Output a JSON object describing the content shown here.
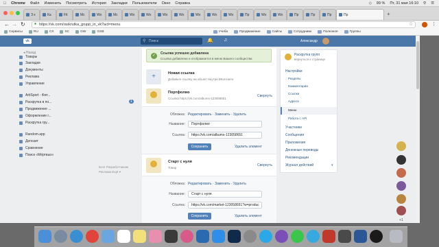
{
  "menubar": {
    "app": "Chrome",
    "items": [
      "Файл",
      "Изменить",
      "Посмотреть",
      "История",
      "Закладки",
      "Пользователи",
      "Окно",
      "Справка"
    ],
    "battery": "99 %",
    "clock": "Пт, 31 мая 16:10"
  },
  "tabs": [
    "З к",
    "Ка",
    "Fit",
    "Mc",
    "Wo",
    "Mc",
    "Wo",
    "Wo",
    "Wo",
    "Wo",
    "Wo",
    "Wo",
    "Wo",
    "Пр",
    "Wo",
    "Wo",
    "Пр",
    "Пр",
    "Пр",
    "Пр"
  ],
  "addressbar": {
    "url": "https://vk.com/raskrutka_grupp_in_vk?act=menu"
  },
  "bookmarks": {
    "items": [
      "Сервисы",
      "RU",
      "CX",
      "SC",
      "GW",
      "GSB"
    ],
    "folders": [
      "Учеба",
      "Продвижение",
      "Сайты",
      "Сотрудники",
      "Полезное",
      "Группы"
    ]
  },
  "vk": {
    "search_placeholder": "Поиск",
    "user_name": "Александр"
  },
  "left_nav": {
    "back": "Назад",
    "items": [
      "Товары",
      "Закладки",
      "Документы",
      "Реклама",
      "Управление",
      "ArtiSport - Фит...",
      "Раскрутка в по...",
      "Продвижение ...",
      "Оформление г...",
      "Раскрутка гру..."
    ],
    "counts": [
      "",
      "",
      "",
      "",
      "",
      "",
      "1",
      "",
      "",
      ""
    ],
    "apps": [
      "Random.app",
      "Депозит",
      "Сравнение",
      "Поиск «Мёртвых»"
    ],
    "footer": "Блог  Разработчикам  Реклама  Ещё ▾"
  },
  "toast": {
    "title": "Ссылка успешно добавлена",
    "text": "Ссылка добавлена и отображается в меню Вашего сообщества"
  },
  "new_link": {
    "title": "Новая ссылка",
    "sub": "Добавьте ссылку на объект внутри ВКонтакте"
  },
  "link1": {
    "title": "Портфолио",
    "sub": "Ссылка https://vk.com/albums-123058651",
    "collapse": "Свернуть",
    "cover_label": "Обложка:",
    "cover_actions": "Редактировать · Заменить · Удалить",
    "name_label": "Название:",
    "name_value": "Портфолио",
    "url_label": "Ссылка:",
    "url_value": "https://vk.com/albums-123058651",
    "save": "Сохранить",
    "delete": "Удалить элемент"
  },
  "link2": {
    "title": "Старт с нуля",
    "sub": "Товар",
    "collapse": "Свернуть",
    "cover_label": "Обложка:",
    "cover_actions": "Редактировать · Заменить · Удалить",
    "name_label": "Название:",
    "name_value": "Старт с нуля",
    "url_label": "Ссылка:",
    "url_value": "https://vk.com/market-123058651?w=produc",
    "save": "Сохранить",
    "delete": "Удалить элемент"
  },
  "right_panel": {
    "group_title": "Раскрутка групп",
    "group_back": "вернуться к странице",
    "items": [
      "Настройки",
      "Разделы",
      "Комментарии",
      "Ссылки",
      "Адреса",
      "Меню",
      "Работа с API",
      "Участники",
      "Сообщения",
      "Приложения",
      "Денежные переводы",
      "Рекомендации",
      "Журнал действий"
    ],
    "active": "Меню"
  },
  "side_counter": "+1"
}
